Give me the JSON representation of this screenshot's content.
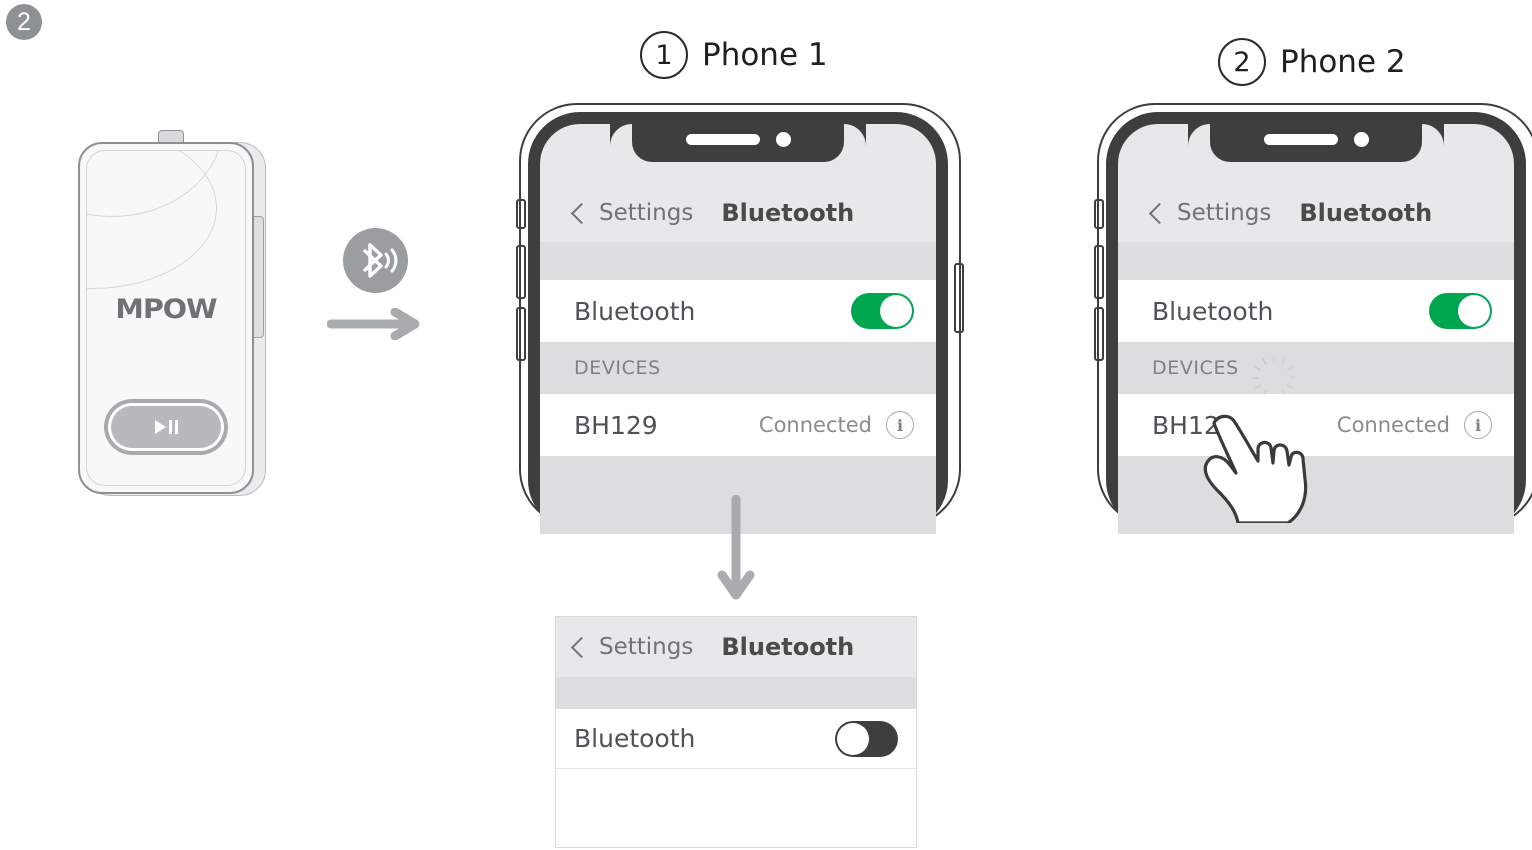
{
  "step": {
    "number": "2"
  },
  "device": {
    "brand_logo": "MPOW",
    "button_icon": "play-pause-icon",
    "pair_icon": "bluetooth-icon",
    "flow_icon": "arrow-right-icon"
  },
  "phones": [
    {
      "header_number": "1",
      "header_label": "Phone 1",
      "nav": {
        "back_label": "Settings",
        "title": "Bluetooth",
        "back_icon": "chevron-left-icon"
      },
      "bluetooth_row": {
        "label": "Bluetooth",
        "toggle_state": "on"
      },
      "section": {
        "label": "DEVICES",
        "spinner": false
      },
      "device_row": {
        "name": "BH129",
        "status": "Connected",
        "info_icon": "info-circle-icon"
      },
      "hand": false
    },
    {
      "header_number": "2",
      "header_label": "Phone 2",
      "nav": {
        "back_label": "Settings",
        "title": "Bluetooth",
        "back_icon": "chevron-left-icon"
      },
      "bluetooth_row": {
        "label": "Bluetooth",
        "toggle_state": "on"
      },
      "section": {
        "label": "DEVICES",
        "spinner": true,
        "spinner_icon": "loading-spinner-icon"
      },
      "device_row": {
        "name": "BH129",
        "status": "Connected",
        "info_icon": "info-circle-icon"
      },
      "hand": true,
      "hand_icon": "hand-tap-icon"
    }
  ],
  "flow_down_icon": "arrow-down-icon",
  "result_panel": {
    "nav": {
      "back_label": "Settings",
      "title": "Bluetooth",
      "back_icon": "chevron-left-icon"
    },
    "bluetooth_row": {
      "label": "Bluetooth",
      "toggle_state": "off"
    }
  },
  "colors": {
    "toggle_on": "#00a550",
    "toggle_off": "#3e3e3e",
    "frame": "#3e3e3e",
    "badge_gray": "#8e9194",
    "arrow_gray": "#a9acaf",
    "nav_bg": "#e7e8e9",
    "section_bg": "#dcdddf",
    "text_dark": "#4a4a4a",
    "text_muted": "#888c8f"
  }
}
